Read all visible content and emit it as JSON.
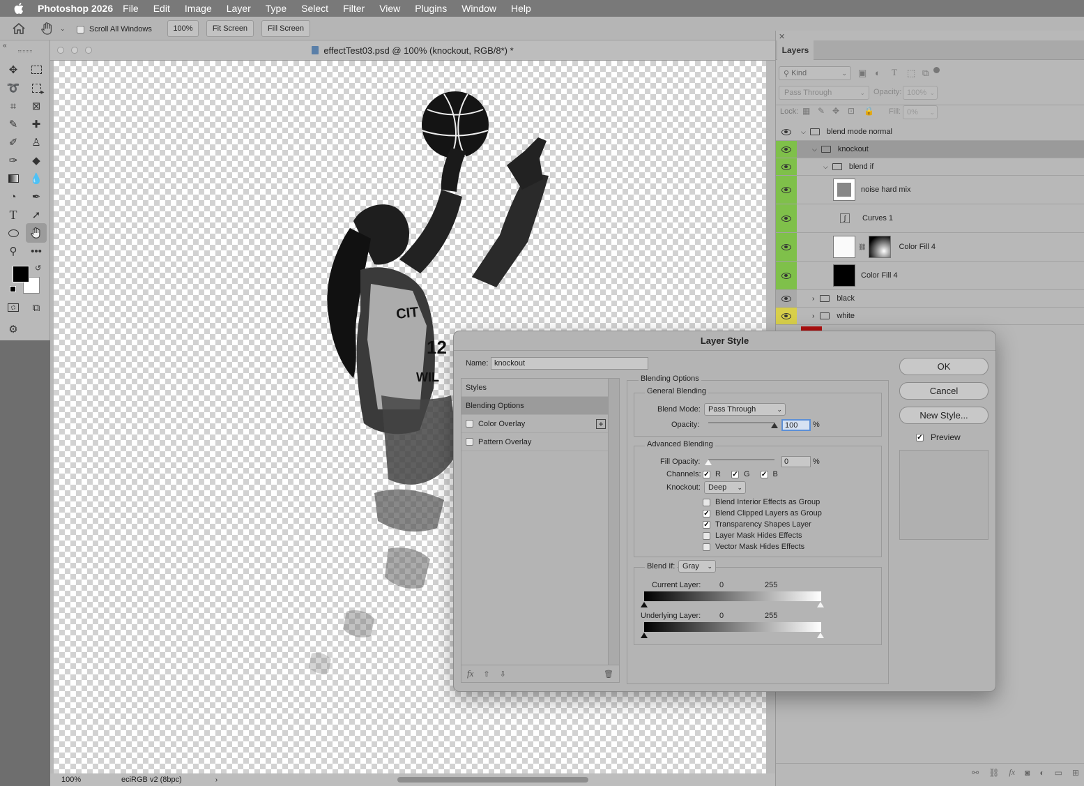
{
  "menubar": {
    "app_name": "Photoshop 2026",
    "items": [
      "File",
      "Edit",
      "Image",
      "Layer",
      "Type",
      "Select",
      "Filter",
      "View",
      "Plugins",
      "Window",
      "Help"
    ]
  },
  "options": {
    "scroll_all_windows": "Scroll All Windows",
    "zoom_btn": "100%",
    "fit_screen": "Fit Screen",
    "fill_screen": "Fill Screen"
  },
  "document": {
    "title": "effectTest03.psd @ 100% (knockout, RGB/8*) *",
    "zoom": "100%",
    "profile": "eciRGB v2 (8bpc)"
  },
  "layers_panel": {
    "tab": "Layers",
    "filter_kind": "Kind",
    "blend_mode": "Pass Through",
    "opacity_label": "Opacity:",
    "opacity_value": "100%",
    "lock_label": "Lock:",
    "fill_label": "Fill:",
    "fill_value": "0%",
    "layers": [
      {
        "name": "blend mode normal"
      },
      {
        "name": "knockout"
      },
      {
        "name": "blend if"
      },
      {
        "name": "noise hard mix"
      },
      {
        "name": "Curves 1"
      },
      {
        "name": "Color Fill 4"
      },
      {
        "name": "Color Fill 4"
      },
      {
        "name": "black"
      },
      {
        "name": "white"
      }
    ]
  },
  "dialog": {
    "title": "Layer Style",
    "name_label": "Name:",
    "name_value": "knockout",
    "styles_list": {
      "styles": "Styles",
      "blending_options": "Blending Options",
      "color_overlay": "Color Overlay",
      "pattern_overlay": "Pattern Overlay"
    },
    "buttons": {
      "ok": "OK",
      "cancel": "Cancel",
      "new_style": "New Style...",
      "preview": "Preview"
    },
    "section_title": "Blending Options",
    "general": {
      "title": "General Blending",
      "blend_mode_label": "Blend Mode:",
      "blend_mode_value": "Pass Through",
      "opacity_label": "Opacity:",
      "opacity_value": "100",
      "percent": "%",
      "opacity_level": 1.0
    },
    "advanced": {
      "title": "Advanced Blending",
      "fill_opacity_label": "Fill Opacity:",
      "fill_opacity_value": "0",
      "percent": "%",
      "fill_level": 0.0,
      "channels_label": "Channels:",
      "channel_r": "R",
      "channel_g": "G",
      "channel_b": "B",
      "knockout_label": "Knockout:",
      "knockout_value": "Deep",
      "options": [
        {
          "label": "Blend Interior Effects as Group",
          "checked": false
        },
        {
          "label": "Blend Clipped Layers as Group",
          "checked": true
        },
        {
          "label": "Transparency Shapes Layer",
          "checked": true
        },
        {
          "label": "Layer Mask Hides Effects",
          "checked": false
        },
        {
          "label": "Vector Mask Hides Effects",
          "checked": false
        }
      ]
    },
    "blend_if": {
      "label": "Blend If:",
      "value": "Gray",
      "current_label": "Current Layer:",
      "current_low": "0",
      "current_high": "255",
      "underlying_label": "Underlying Layer:",
      "underlying_low": "0",
      "underlying_high": "255"
    }
  }
}
